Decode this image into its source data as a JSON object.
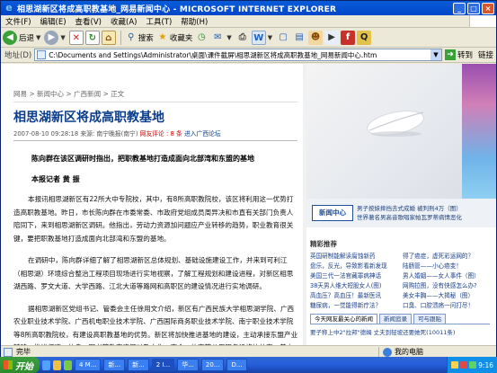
{
  "window": {
    "title": "相思湖新区将成高职教基地_网易新闻中心 - MICROSOFT INTERNET EXPLORER",
    "controls": [
      "_",
      "□",
      "×"
    ]
  },
  "menu": [
    "文件(F)",
    "编辑(E)",
    "查看(V)",
    "收藏(A)",
    "工具(T)",
    "帮助(H)"
  ],
  "toolbar": {
    "back_label": "后退",
    "search_label": "搜索",
    "favorites_label": "收藏夹"
  },
  "address": {
    "label": "地址(D)",
    "url": "C:\\Documents and Settings\\Administrator\\桌面\\课件截屏\\相思湖新区将成高职教基地_网易新闻中心.htm",
    "go_label": "转到",
    "links_label": "链接"
  },
  "article": {
    "breadcrumb": "网易 > 新闻中心 > 广西新闻 > 正文",
    "title": "相思湖新区将成高职教基地",
    "meta_date": "2007-08-10 09:28:18",
    "meta_source": "来源: 南宁晚报(南宁)",
    "meta_comment": "网友评论 : 8 条",
    "meta_forum": "进入广西论坛",
    "lead": "陈向群在该区调研时指出，把职教基地打造成面向北部湾和东盟的基地",
    "reporter": "本报记者 黄 振",
    "paragraphs": [
      "本报讯相思湖新区有22所大中专院校，其中，有8所高职教院校，该区将利用这一优势打造高职教基地。昨日，市长陈向群在市委常委、市政府党组成员周异决和市直有关部门负责人陪同下，来到相思湖新区调研。他指出，劳动力资源加问题应产业转移的趋势，职业教育很关键，要把职教基地打造成面向北部湾和东盟的基地。",
      "在调研中，陈向群详细了解了相思湖新区总体规划、基础设施建设工作，并来到可利江（相思湖）环境综合整治工程项目现场进行实地视察，了解工程规划和建设进程，对新区相思湖西路、罗文大道、大学西路、江北大道等路网和高职区的建设情况进行实地调研。",
      "据相思湖新区党组书记、管委会主任徐用文介绍，新区有广西民族大学相思湖学院、广西农业职业技术学院、广西机电职业技术学院、广西国际商务职业技术学院、南宁职业技术学院等8所高职教院校，有建设高职教基地的优势。新区将加快推进基地的建设，主动承接东盟产业转移，推进师资、信息、图书等教育资源以及文化、商会、体育等公用服务设施的共享，着力建设小语种人才、物流服务人才、技能人才等特色培训基地。目前，广西民族大学相思湖学院..."
    ]
  },
  "sidebar": {
    "news_center_label": "新闻中心",
    "news_lines": [
      "男子按妹摔挡去式成婚  被判刑4万（图）",
      "世界著名男高音歌唱家帕瓦罗蒂病情恶化"
    ],
    "recommend_title": "精彩推荐",
    "recommend_items": [
      "英国研制能解读腐蚀新药",
      "得了癌症，虚死彩运网的？",
      "盘乐，反光，导致影看新发现",
      "陆肠管——小心癌变！",
      "美国三代一法官藏罪病神话",
      "男人婚姻——女人事件（图）",
      "38天男人维大短股女人(图)",
      "网购拉图，没有快感怎么办?",
      "高血压？高血压！最新医讯",
      "美女丰胸——大揭秘（图）",
      "糖尿病，一觉能得新疗法？",
      "口臭、口腔溃疡一问打尽！"
    ],
    "tabs": [
      "今天网友最关心的新闻",
      "新闻追录",
      "可与跟贴"
    ],
    "hot_news": "要子称上中2\"拉邦\"德姆  丈夫到轻坡还要她死(10011条)"
  },
  "status": {
    "left_text": "完毕",
    "zone_text": "我的电脑"
  },
  "taskbar": {
    "start_label": "开始",
    "tasks": [
      "4 M...",
      "新...",
      "新...",
      "2 I...",
      "华...",
      "20...",
      "D..."
    ],
    "clock": "9:16"
  }
}
